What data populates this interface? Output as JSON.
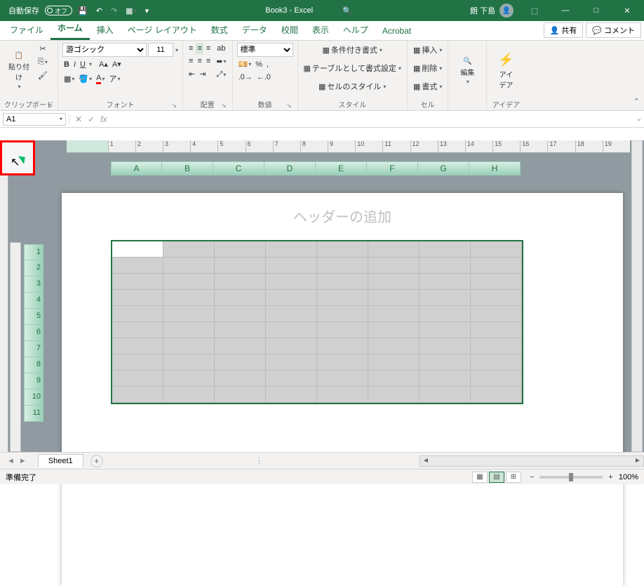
{
  "titlebar": {
    "autosave_label": "自動保存",
    "autosave_state": "オフ",
    "title": "Book3 - Excel",
    "user_name": "朗 下島"
  },
  "tabs": {
    "file": "ファイル",
    "home": "ホーム",
    "insert": "挿入",
    "page_layout": "ページ レイアウト",
    "formulas": "数式",
    "data": "データ",
    "review": "校閲",
    "view": "表示",
    "help": "ヘルプ",
    "acrobat": "Acrobat",
    "share": "共有",
    "comments": "コメント"
  },
  "ribbon": {
    "clipboard": {
      "paste": "貼り付け",
      "label": "クリップボード"
    },
    "font": {
      "name": "游ゴシック",
      "size": "11",
      "bold": "B",
      "italic": "I",
      "underline": "U",
      "label": "フォント"
    },
    "alignment": {
      "wrap": "ab",
      "label": "配置"
    },
    "number": {
      "format": "標準",
      "label": "数値"
    },
    "styles": {
      "conditional": "条件付き書式",
      "table": "テーブルとして書式設定",
      "cell": "セルのスタイル",
      "label": "スタイル"
    },
    "cells": {
      "insert": "挿入",
      "delete": "削除",
      "format": "書式",
      "label": "セル"
    },
    "editing": {
      "label": "編集"
    },
    "ideas": {
      "btn": "アイ\nデア",
      "label": "アイデア"
    }
  },
  "formula_bar": {
    "cell_ref": "A1",
    "fx": "fx"
  },
  "ruler": [
    "1",
    "2",
    "3",
    "4",
    "5",
    "6",
    "7",
    "8",
    "9",
    "10",
    "11",
    "12",
    "13",
    "14",
    "15",
    "16",
    "17",
    "18",
    "19"
  ],
  "col_headers": [
    "A",
    "B",
    "C",
    "D",
    "E",
    "F",
    "G",
    "H"
  ],
  "row_headers": [
    "1",
    "2",
    "3",
    "4",
    "5",
    "6",
    "7",
    "8",
    "9",
    "10",
    "11"
  ],
  "page": {
    "header_placeholder": "ヘッダーの追加"
  },
  "sheet_tabs": {
    "sheet1": "Sheet1"
  },
  "statusbar": {
    "ready": "準備完了",
    "zoom": "100%"
  }
}
